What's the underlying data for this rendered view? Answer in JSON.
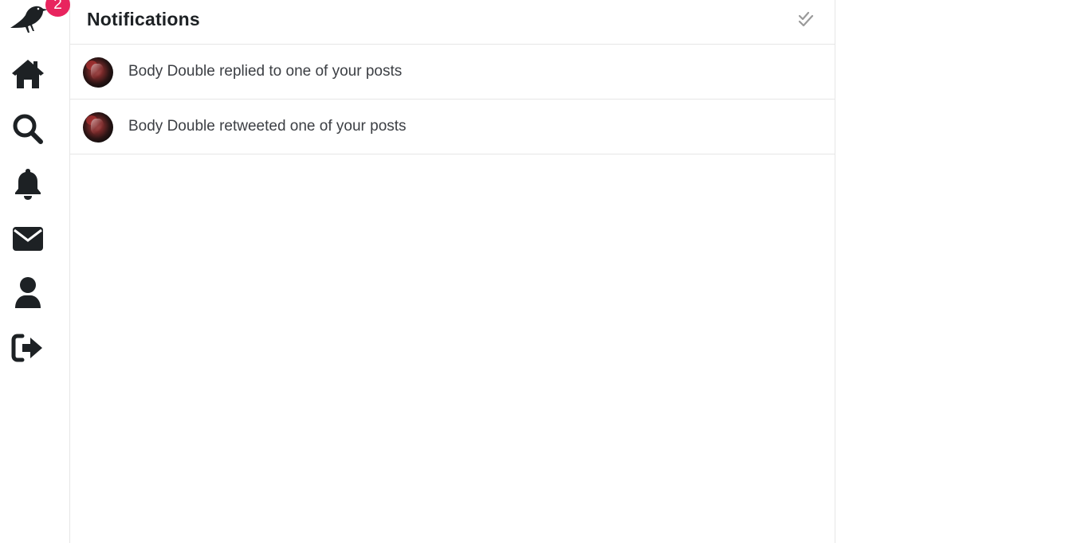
{
  "sidebar": {
    "logo_icon": "crow-icon",
    "unread_count": "2",
    "items": [
      {
        "icon": "home-icon"
      },
      {
        "icon": "search-icon"
      },
      {
        "icon": "bell-icon"
      },
      {
        "icon": "envelope-icon"
      },
      {
        "icon": "user-icon"
      },
      {
        "icon": "logout-icon"
      }
    ]
  },
  "header": {
    "title": "Notifications",
    "mark_all_icon": "double-check-icon"
  },
  "notifications": [
    {
      "text": "Body Double replied to one of your posts"
    },
    {
      "text": "Body Double retweeted one of your posts"
    }
  ],
  "colors": {
    "badge": "#e8245e",
    "icon": "#1d2124",
    "border": "#e6e6e6",
    "text": "#3c3f44"
  }
}
